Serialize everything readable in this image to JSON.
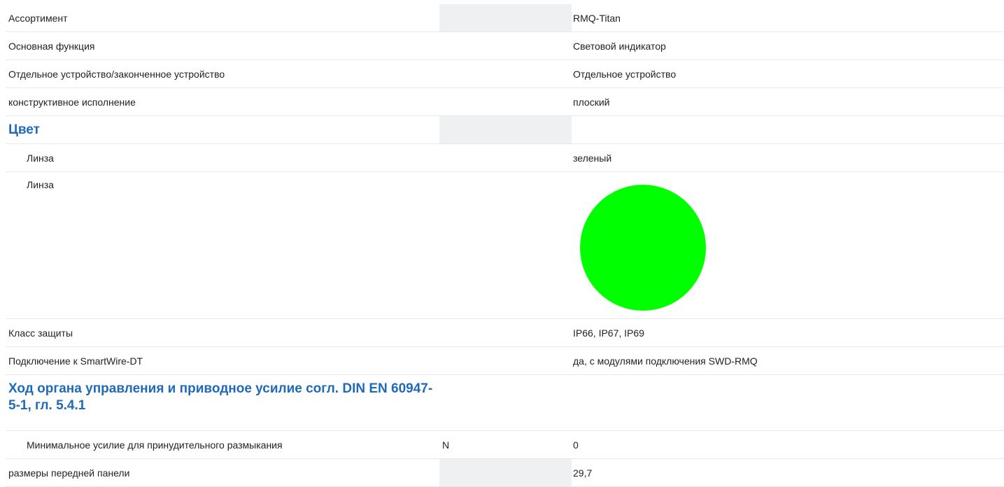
{
  "rows": [
    {
      "label": "Ассортимент",
      "unit": "",
      "value": "RMQ-Titan"
    },
    {
      "label": "Основная функция",
      "unit": "",
      "value": "Световой индикатор"
    },
    {
      "label": "Отдельное устройство/законченное устройство",
      "unit": "",
      "value": "Отдельное устройство"
    },
    {
      "label": "конструктивное исполнение",
      "unit": "",
      "value": "плоский"
    },
    {
      "section": "Цвет"
    },
    {
      "label": "Линза",
      "unit": "",
      "value": "зеленый"
    },
    {
      "label": "Линза",
      "swatch_color": "#00ff00"
    },
    {
      "label": "Класс защиты",
      "unit": "",
      "value": "IP66, IP67, IP69"
    },
    {
      "label": "Подключение к SmartWire-DT",
      "unit": "",
      "value": "да, с модулями подключения SWD-RMQ"
    },
    {
      "section": "Ход органа управления и приводное усилие согл. DIN EN 60947-5-1, гл. 5.4.1"
    },
    {
      "label": "Минимальное усилие для принудительного размыкания",
      "unit": "N",
      "value": "0"
    },
    {
      "label": "размеры передней панели",
      "unit": "",
      "value": "29,7"
    }
  ]
}
